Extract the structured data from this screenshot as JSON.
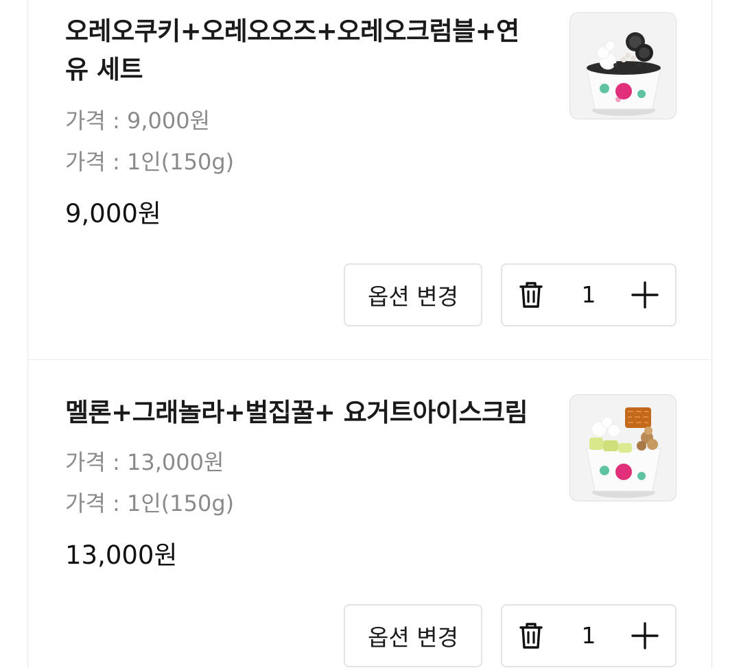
{
  "items": [
    {
      "title_line1": "오레오쿠키+오레오오즈+오레오크럼블+연",
      "title_line2": "유 세트",
      "meta1": "가격 : 9,000원",
      "meta2": "가격 : 1인(150g)",
      "price": "9,000원",
      "option_button": "옵션 변경",
      "quantity": "1",
      "thumbnail_icon": "oreo-yogurt-ice-cream-cup-image"
    },
    {
      "title_line1": "멜론+그래놀라+벌집꿀+ 요거트아이스크림",
      "meta1": "가격 : 13,000원",
      "meta2": "가격 : 1인(150g)",
      "price": "13,000원",
      "option_button": "옵션 변경",
      "quantity": "1",
      "thumbnail_icon": "melon-granola-yogurt-ice-cream-cup-image"
    }
  ],
  "icons": {
    "delete": "trash-icon",
    "increase": "plus-icon"
  },
  "colors": {
    "cup_pink": "#e0307a",
    "cup_green": "#5fc3a3",
    "border": "#e3e3e3",
    "muted_text": "#8a8a8a"
  }
}
